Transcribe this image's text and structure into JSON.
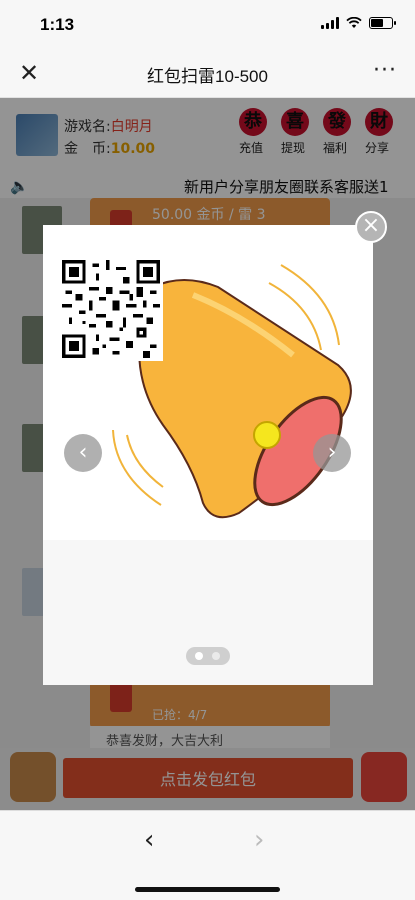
{
  "status": {
    "time": "1:13"
  },
  "nav": {
    "close_icon": "close-icon",
    "title": "红包扫雷10-500",
    "more_icon": "more-icon"
  },
  "profile": {
    "game_name_label": "游戏名:",
    "game_name": "白明月",
    "coin_label": "金　币:",
    "coin": "10.00"
  },
  "quick_actions": [
    {
      "glyph": "恭",
      "label": "充值"
    },
    {
      "glyph": "喜",
      "label": "提现"
    },
    {
      "glyph": "發",
      "label": "福利"
    },
    {
      "glyph": "財",
      "label": "分享"
    }
  ],
  "marquee": {
    "text": "新用户分享朋友圈联系客服送1"
  },
  "feed": {
    "packets": [
      {
        "text": "50.00 金币 / 雷 3",
        "claim": ""
      },
      {
        "text": "",
        "claim": "已抢：4/7"
      }
    ],
    "blessing": "恭喜发财，大吉大利"
  },
  "bottom": {
    "send_label": "点击发包红包"
  },
  "modal": {
    "prev_icon": "chevron-left-icon",
    "next_icon": "chevron-right-icon",
    "close_icon": "close-icon",
    "active_page": 1,
    "page_count": 2
  },
  "browser": {
    "back_icon": "back-arrow-icon",
    "forward_icon": "forward-arrow-icon"
  },
  "colors": {
    "accent": "#e2502f",
    "packet": "#f29c4a",
    "name": "#e53b2c",
    "coin": "#e8a400",
    "bell": "#f8b43c",
    "bell_inner": "#ef6f6c"
  }
}
